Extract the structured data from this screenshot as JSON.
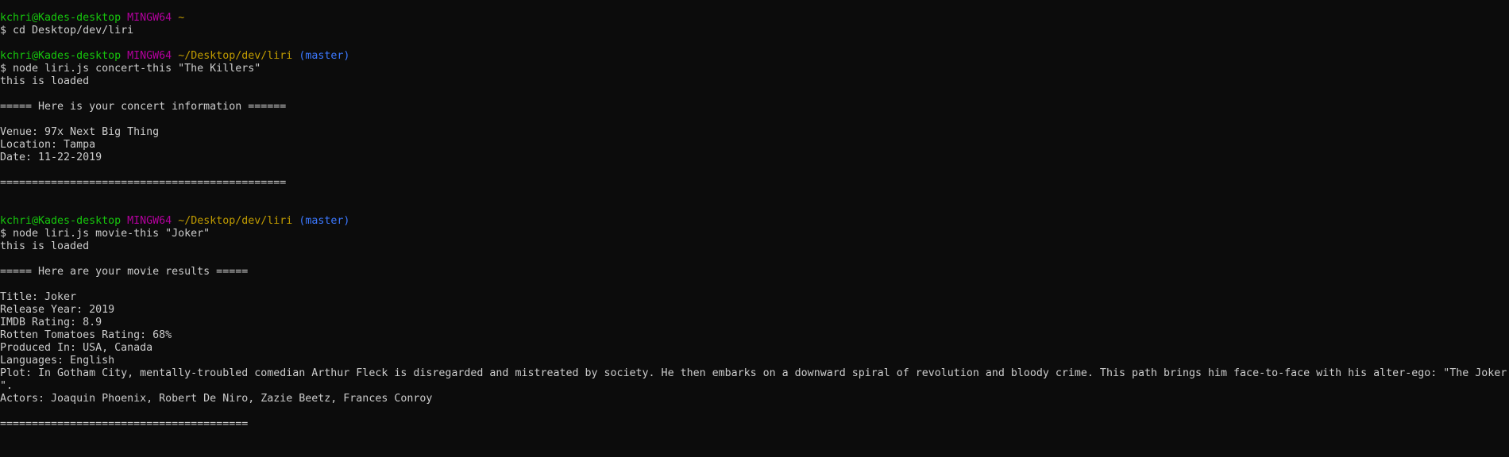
{
  "prompt1": {
    "user": "kchri@Kades-desktop",
    "system": "MINGW64",
    "path": "~"
  },
  "command1": "$ cd Desktop/dev/liri",
  "prompt2": {
    "user": "kchri@Kades-desktop",
    "system": "MINGW64",
    "path": "~/Desktop/dev/liri",
    "branch": "(master)"
  },
  "command2": "$ node liri.js concert-this \"The Killers\"",
  "concert": {
    "loaded": "this is loaded",
    "header": "===== Here is your concert information ======",
    "venue": "Venue: 97x Next Big Thing",
    "location": "Location: Tampa",
    "date": "Date: 11-22-2019",
    "footer": "============================================="
  },
  "prompt3": {
    "user": "kchri@Kades-desktop",
    "system": "MINGW64",
    "path": "~/Desktop/dev/liri",
    "branch": "(master)"
  },
  "command3": "$ node liri.js movie-this \"Joker\"",
  "movie": {
    "loaded": "this is loaded",
    "header": "===== Here are your movie results =====",
    "title": "Title: Joker",
    "year": "Release Year: 2019",
    "imdb": "IMDB Rating: 8.9",
    "rotten": "Rotten Tomatoes Rating: 68%",
    "produced": "Produced In: USA, Canada",
    "languages": "Languages: English",
    "plot": "Plot: In Gotham City, mentally-troubled comedian Arthur Fleck is disregarded and mistreated by society. He then embarks on a downward spiral of revolution and bloody crime. This path brings him face-to-face with his alter-ego: \"The Joker",
    "plot_wrap": "\".",
    "actors": "Actors: Joaquin Phoenix, Robert De Niro, Zazie Beetz, Frances Conroy",
    "footer": "======================================="
  }
}
